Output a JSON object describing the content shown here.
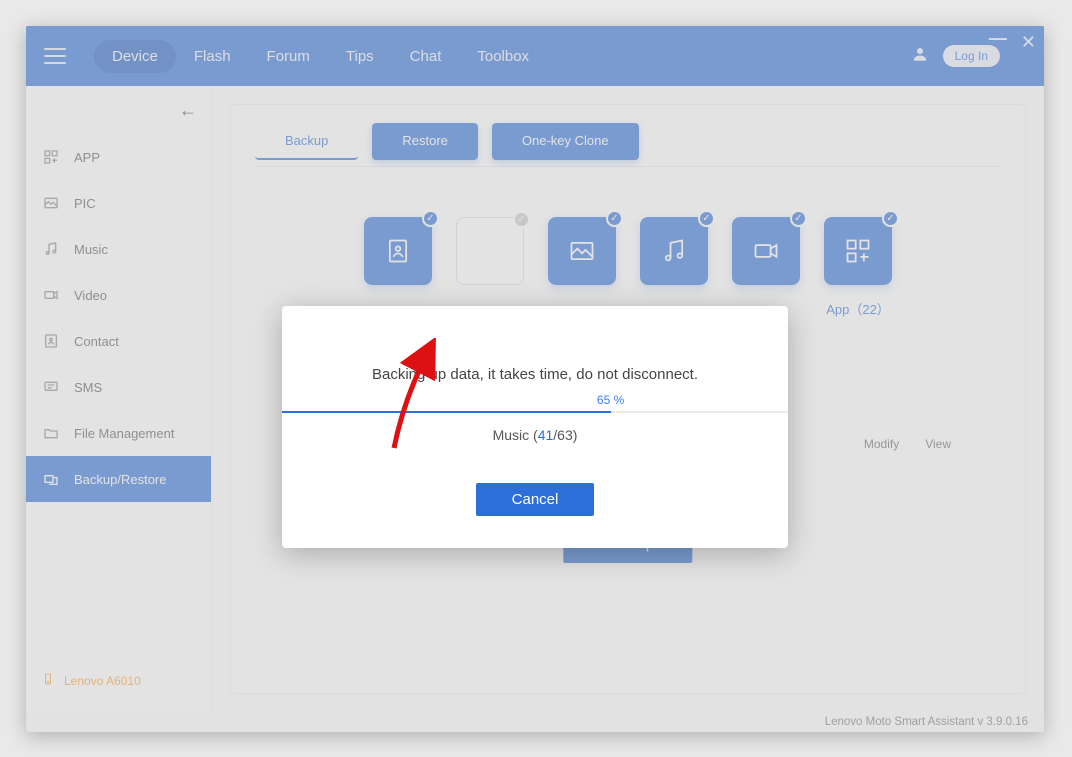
{
  "nav": {
    "items": [
      "Device",
      "Flash",
      "Forum",
      "Tips",
      "Chat",
      "Toolbox"
    ],
    "active_index": 0,
    "login_label": "Log In"
  },
  "sidebar": {
    "items": [
      {
        "label": "APP"
      },
      {
        "label": "PIC"
      },
      {
        "label": "Music"
      },
      {
        "label": "Video"
      },
      {
        "label": "Contact"
      },
      {
        "label": "SMS"
      },
      {
        "label": "File Management"
      },
      {
        "label": "Backup/Restore"
      }
    ],
    "active_index": 7,
    "device_label": "Lenovo A6010"
  },
  "tabs": {
    "items": [
      "Backup",
      "Restore",
      "One-key Clone"
    ],
    "active_index": 0
  },
  "tiles": {
    "app": {
      "label": "App（22）"
    }
  },
  "actions": {
    "modify": "Modify",
    "view": "View"
  },
  "buttons": {
    "backup": "Backup"
  },
  "modal": {
    "message": "Backing up data, it takes time, do not disconnect.",
    "percent": 65,
    "percent_label": "65 %",
    "item_label_prefix": "Music (",
    "item_current": "41",
    "item_sep": "/",
    "item_total": "63",
    "item_label_suffix": ")",
    "cancel": "Cancel"
  },
  "footer": "Lenovo Moto Smart Assistant v 3.9.0.16"
}
